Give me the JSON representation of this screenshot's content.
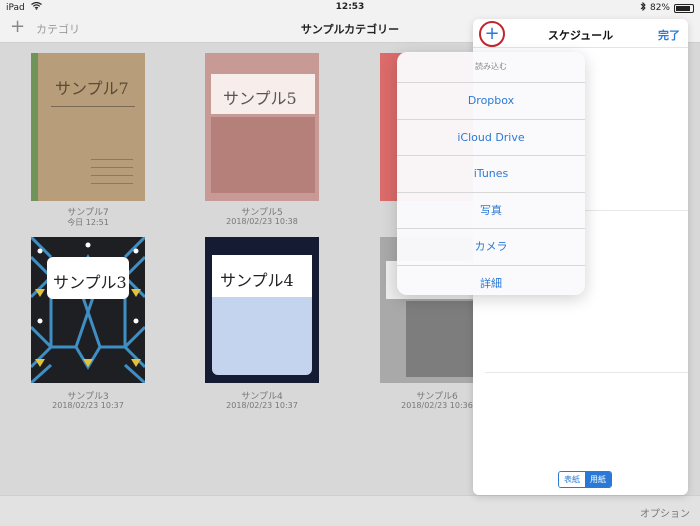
{
  "status_bar": {
    "device": "iPad",
    "time": "12:53",
    "battery": "82%"
  },
  "nav": {
    "add_label": "+",
    "category_label": "カテゴリ",
    "title": "サンプルカテゴリー"
  },
  "books": [
    {
      "name": "サンプル7",
      "date": "今日 12:51",
      "cover_text": "サンプル7"
    },
    {
      "name": "サンプル5",
      "date": "2018/02/23 10:38",
      "cover_text": "サンプル5"
    },
    {
      "name": "サンプル3",
      "date": "2018/02/23 10:37",
      "cover_text": "サンプル3"
    },
    {
      "name": "サンプル4",
      "date": "2018/02/23 10:37",
      "cover_text": "サンプル4"
    },
    {
      "name": "サンプル6",
      "date": "2018/02/23 10:36"
    }
  ],
  "schedule_panel": {
    "plus_label": "+",
    "title": "スケジュール",
    "done_label": "完了",
    "segment": {
      "cover_label": "表紙",
      "paper_label": "用紙",
      "selected": "用紙"
    }
  },
  "import_menu": {
    "header": "読み込む",
    "items": [
      "Dropbox",
      "iCloud Drive",
      "iTunes",
      "写真",
      "カメラ",
      "詳細"
    ]
  },
  "bottom_bar": {
    "option_label": "オプション"
  },
  "colors": {
    "accent": "#2a79d6",
    "highlight_ring": "#c0272d"
  }
}
